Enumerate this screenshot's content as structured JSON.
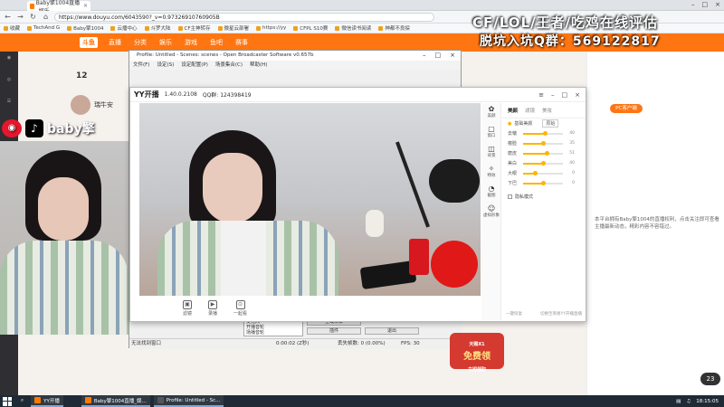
{
  "browser": {
    "tab_title": "Baby擎1004直播_娱乐",
    "url": "https://www.douyu.com/6043590?_v=0.97326910760905B",
    "bookmarks": [
      "收藏",
      "TechAnd G",
      "Baby擎1004",
      "云播中心",
      "斗罗大陆",
      "CF主神转存",
      "微星云部署",
      "https://yy",
      "CFPL S10赛",
      "微信读书阅读",
      "神都不良探"
    ]
  },
  "douyu": {
    "logo": "斗鱼",
    "nav": [
      "直播",
      "分类",
      "娱乐",
      "游戏",
      "鱼吧",
      "赛事"
    ],
    "anchor_name": "瑞牛安",
    "stat_value": "12",
    "pc_badge": "PC客户端",
    "right_text": "本平台拥有Baby擎1004的直播权利，点击关注即可查看主播最新动态，精彩内容不容错过。",
    "viewers": "23"
  },
  "overlay": {
    "line1": "CF/LOL/王者/吃鸡在线评估",
    "line2": "脱坑入坑Q群：569122817",
    "social_name": "baby擎"
  },
  "obs": {
    "title": "Profile: Untitled - Scenes: scenes - Open Broadcaster Software v0.657b",
    "menu": [
      "文件(F)",
      "设定(S)",
      "设定配置(P)",
      "场景集合(C)",
      "帮助(H)"
    ],
    "list_items": [
      "麦克风",
      "开播音轮",
      "场播音轮"
    ],
    "buttons": [
      "全域未录",
      "插件",
      "退出"
    ],
    "status_left": "无法找到窗口",
    "status_mid": "0:00:02 (Z秒)",
    "status_drop": "丢失帧数: 0 (0.00%)",
    "status_fps": "FPS: 30"
  },
  "yy": {
    "logo": "YY开播",
    "version": "1.40.0.2108",
    "qq": "QQ群: 124398419",
    "controls": [
      "滤镜",
      "录播",
      "一起看"
    ],
    "side": [
      "美颜",
      "窗口",
      "背景",
      "特效",
      "截图",
      "虚拟形象"
    ],
    "panel_tabs": [
      "美颜",
      "滤镜",
      "美妆"
    ],
    "basic_label": "基础美颜",
    "preset_label": "原始",
    "sliders": [
      {
        "label": "去皱",
        "value": "40",
        "level": 0.55
      },
      {
        "label": "瘦脸",
        "value": "35",
        "level": 0.5
      },
      {
        "label": "磨皮",
        "value": "51",
        "level": 0.6
      },
      {
        "label": "美白",
        "value": "40",
        "level": 0.5
      },
      {
        "label": "大眼",
        "value": "0",
        "level": 0.3
      },
      {
        "label": "下巴",
        "value": "0",
        "level": 0.5
      }
    ],
    "check_label": "隐私模式",
    "foot_left": "一键恢复",
    "foot_right": "切换至简易YY开播直播"
  },
  "promo": {
    "top": "天赐X1",
    "main": "免费领",
    "sub": "立即领取"
  },
  "taskbar": {
    "items": [
      "YY开播",
      "Baby擎1004直播_娱...",
      "Profile: Untitled - Sc..."
    ],
    "time": "18:15:05"
  },
  "colors": {
    "douyu_orange": "#ff7511",
    "yy_accent": "#ffb400"
  }
}
